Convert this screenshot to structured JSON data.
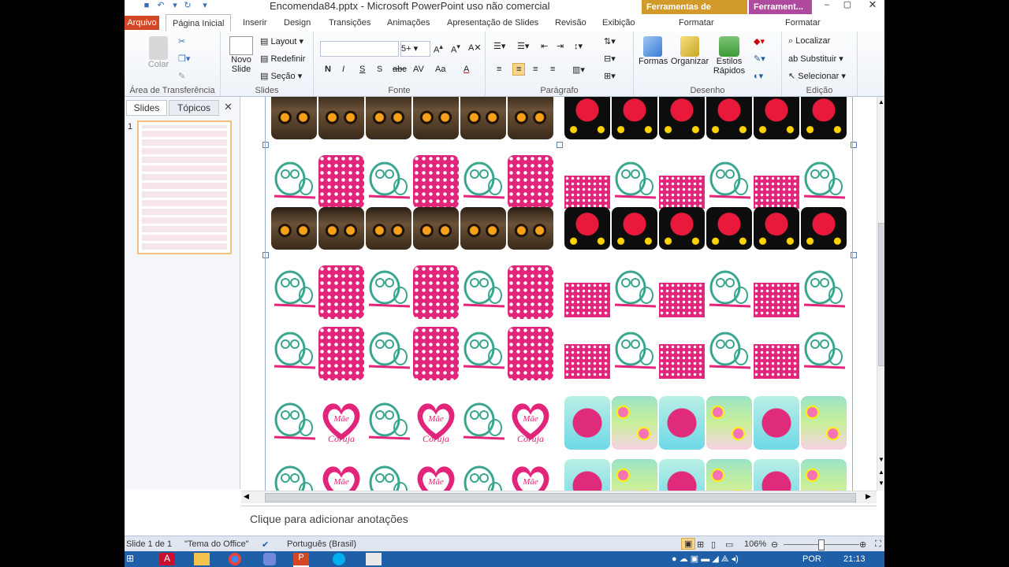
{
  "window": {
    "title": "Encomenda84.pptx - Microsoft PowerPoint uso não comercial",
    "context_tab_1": "Ferramentas de Desenho",
    "context_tab_2": "Ferrament..."
  },
  "tabs": [
    "Arquivo",
    "Página Inicial",
    "Inserir",
    "Design",
    "Transições",
    "Animações",
    "Apresentação de Slides",
    "Revisão",
    "Exibição",
    "Formatar",
    "Formatar"
  ],
  "ribbon": {
    "clipboard": {
      "paste": "Colar",
      "label": "Área de Transferência"
    },
    "slides": {
      "new_slide": "Novo Slide",
      "layout": "Layout",
      "reset": "Redefinir",
      "section": "Seção",
      "label": "Slides"
    },
    "font": {
      "font_name": "",
      "font_size": "5+",
      "bold": "N",
      "italic": "I",
      "underline": "S",
      "shadow": "S",
      "strike": "abc",
      "spacing": "AV",
      "case": "Aa",
      "color": "A",
      "label": "Fonte"
    },
    "paragraph": {
      "label": "Parágrafo"
    },
    "drawing": {
      "shapes": "Formas",
      "arrange": "Organizar",
      "quick_styles": "Estilos Rápidos",
      "label": "Desenho"
    },
    "editing": {
      "find": "Localizar",
      "replace": "Substituir",
      "select": "Selecionar",
      "label": "Edição"
    }
  },
  "panel": {
    "tab_slides": "Slides",
    "tab_outline": "Tópicos",
    "slide_number": "1"
  },
  "notes": {
    "placeholder": "Clique para adicionar anotações"
  },
  "status": {
    "slide": "Slide 1 de 1",
    "theme": "\"Tema do Office\"",
    "language": "Português (Brasil)",
    "zoom": "106%"
  },
  "taskbar": {
    "lang": "POR",
    "time": "21:13"
  },
  "slide_art": {
    "heart_line1": "Mãe",
    "heart_line2": "Coruja"
  }
}
